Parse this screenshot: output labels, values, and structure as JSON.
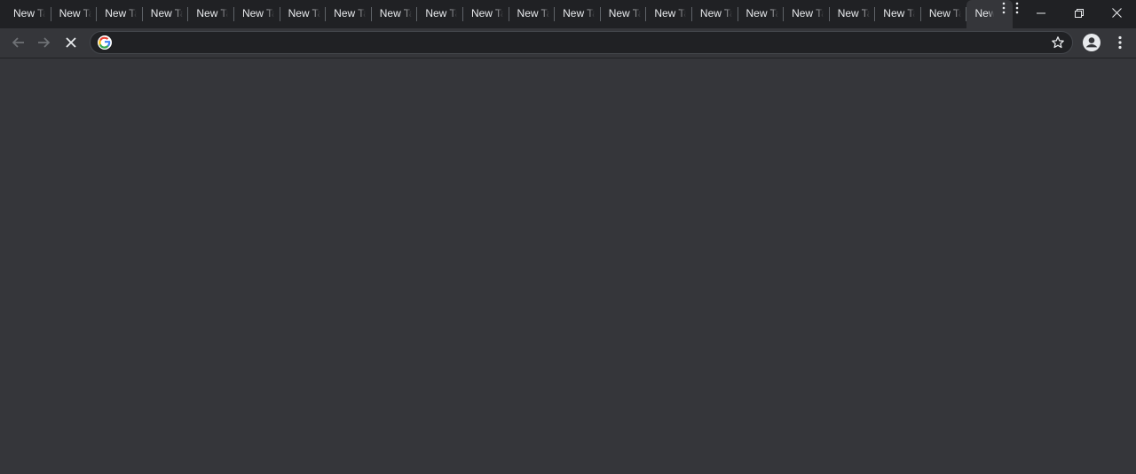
{
  "tabs": [
    {
      "label": "New Ta"
    },
    {
      "label": "New Ta"
    },
    {
      "label": "New Ta"
    },
    {
      "label": "New Ta"
    },
    {
      "label": "New Ta"
    },
    {
      "label": "New Ta"
    },
    {
      "label": "New Ta"
    },
    {
      "label": "New Ta"
    },
    {
      "label": "New Ta"
    },
    {
      "label": "New Ta"
    },
    {
      "label": "New Ta"
    },
    {
      "label": "New Ta"
    },
    {
      "label": "New Ta"
    },
    {
      "label": "New Ta"
    },
    {
      "label": "New Ta"
    },
    {
      "label": "New Ta"
    },
    {
      "label": "New Ta"
    },
    {
      "label": "New Ta"
    },
    {
      "label": "New Ta"
    },
    {
      "label": "New Ta"
    },
    {
      "label": "New Ta"
    },
    {
      "label": "New"
    }
  ],
  "active_tab_index": 21,
  "omnibox": {
    "value": ""
  },
  "icons": {
    "back": "back-arrow-icon",
    "forward": "forward-arrow-icon",
    "stop": "stop-loading-icon",
    "search": "google-logo-icon",
    "bookmark": "star-icon",
    "profile": "profile-avatar-icon",
    "menu": "three-dot-menu-icon"
  },
  "colors": {
    "tabstrip": "#202124",
    "toolbar": "#35363a",
    "omnibox": "#202124",
    "text": "#e8eaed"
  }
}
